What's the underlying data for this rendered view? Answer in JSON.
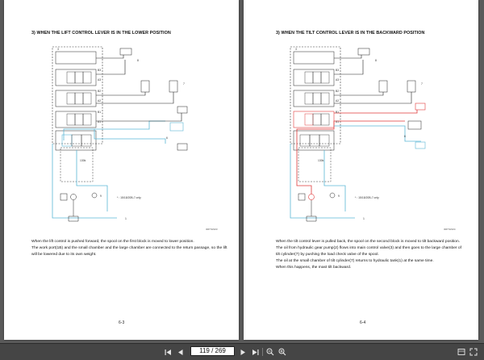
{
  "pages": [
    {
      "title": "3) WHEN THE LIFT CONTROL LEVER IS IN THE LOWER POSITION",
      "paragraphs": [
        "When the lift control is pushed forward, the spool on the first block is moved to lower position.",
        "The work port(1B) and the small chamber and the large chamber are connected to the return passage, so the lift will be lowered due to its own weight."
      ],
      "page_number": "6-3",
      "figure_code": "30P7HS03",
      "labels": {
        "ports": [
          "B3",
          "A3",
          "B2",
          "A2",
          "B1",
          "A1"
        ],
        "callouts": [
          "3",
          "8",
          "7",
          "6",
          "9",
          "1"
        ],
        "valve_text": "130k",
        "note": "* : 15/18/20B-7 only"
      }
    },
    {
      "title": "3) WHEN THE TILT CONTROL LEVER IS IN THE BACKWARD POSITION",
      "paragraphs": [
        "When the tilt control lever is pulled back, the spool on the second block is moved to tilt backward position.",
        "The oil from hydraulic gear pump(2) flows into main control valve(3) and then goes to the large chamber of tilt cylinder(7) by pushing the load check valve of the spool.",
        "The oil at the small chamber of tilt cylinder(7) returns to hydraulic tank(1) at the same time.",
        "When this happens, the mast tilt backward."
      ],
      "page_number": "6-4",
      "figure_code": "30P7HS04",
      "labels": {
        "ports": [
          "B3",
          "A3",
          "B2",
          "A2",
          "B1",
          "A1"
        ],
        "callouts": [
          "3",
          "8",
          "7",
          "6",
          "9",
          "1"
        ],
        "valve_text": "130k",
        "note": "* : 15/18/20B-7 only"
      }
    }
  ],
  "toolbar": {
    "page_input": "119 / 269",
    "first_icon": "first-page-icon",
    "prev_icon": "previous-page-icon",
    "next_icon": "next-page-icon",
    "last_icon": "last-page-icon",
    "zoom_out_icon": "zoom-out-icon",
    "zoom_in_icon": "zoom-in-icon",
    "fit_icon": "fit-page-icon",
    "fullscreen_icon": "fullscreen-icon"
  },
  "colors": {
    "background": "#5a5a5a",
    "toolbar": "#454545",
    "line_return": "#5bb6d6",
    "line_pressure": "#e03a3a",
    "dash": "#333333"
  }
}
